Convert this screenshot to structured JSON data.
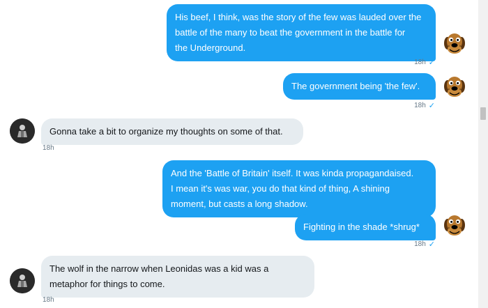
{
  "messages": [
    {
      "lines": [
        "His beef, I think, was the story of the few was lauded over the",
        "battle of the many to beat the government in the battle for",
        "the Underground."
      ],
      "time": "18h"
    },
    {
      "lines": [
        "The government being 'the few'."
      ],
      "time": "18h"
    },
    {
      "lines": [
        "Gonna take a bit to organize my thoughts on some of that."
      ],
      "time": "18h"
    },
    {
      "lines": [
        "And the 'Battle of Britain' itself. It was kinda propagandaised.",
        "I mean it's was war, you do that kind of thing, A shining",
        "moment, but casts a long shadow."
      ]
    },
    {
      "lines": [
        "Fighting in the shade *shrug*"
      ],
      "time": "18h"
    },
    {
      "lines": [
        "The wolf in the narrow when Leonidas was a kid was a",
        "metaphor for things to come."
      ],
      "time": "18h"
    }
  ],
  "icons": {
    "read_receipt": "checkmark-icon",
    "sender_avatar": "scooby-doo-avatar",
    "recipient_avatar": "dark-figure-avatar"
  },
  "colors": {
    "outgoing_bubble": "#1da1f2",
    "incoming_bubble": "#e6ecf0",
    "timestamp": "#657786"
  }
}
